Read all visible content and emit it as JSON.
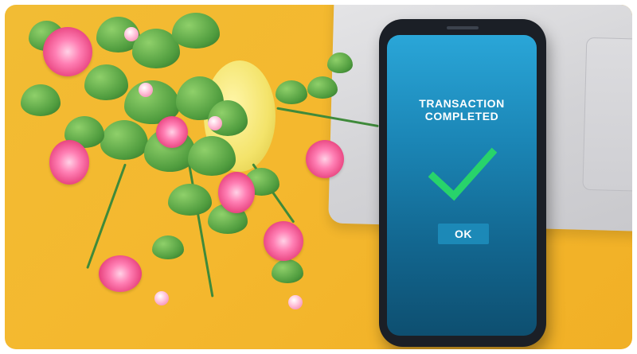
{
  "photo": {
    "background_color": "#f4b82e",
    "phone": {
      "screen": {
        "title": "TRANSACTION\nCOMPLETED",
        "check_icon": "checkmark-icon",
        "check_color": "#28d36b",
        "ok_label": "OK"
      }
    }
  }
}
